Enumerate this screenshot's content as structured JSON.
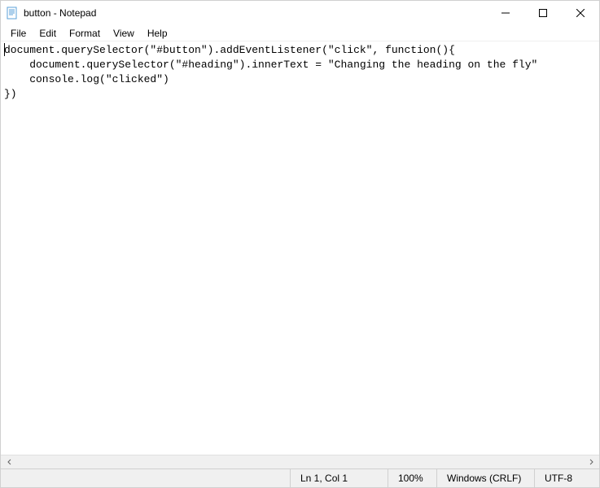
{
  "titlebar": {
    "title": "button - Notepad"
  },
  "menu": {
    "file": "File",
    "edit": "Edit",
    "format": "Format",
    "view": "View",
    "help": "Help"
  },
  "editor": {
    "content": "document.querySelector(\"#button\").addEventListener(\"click\", function(){\n    document.querySelector(\"#heading\").innerText = \"Changing the heading on the fly\"\n    console.log(\"clicked\")\n})"
  },
  "statusbar": {
    "position": "Ln 1, Col 1",
    "zoom": "100%",
    "line_ending": "Windows (CRLF)",
    "encoding": "UTF-8"
  }
}
